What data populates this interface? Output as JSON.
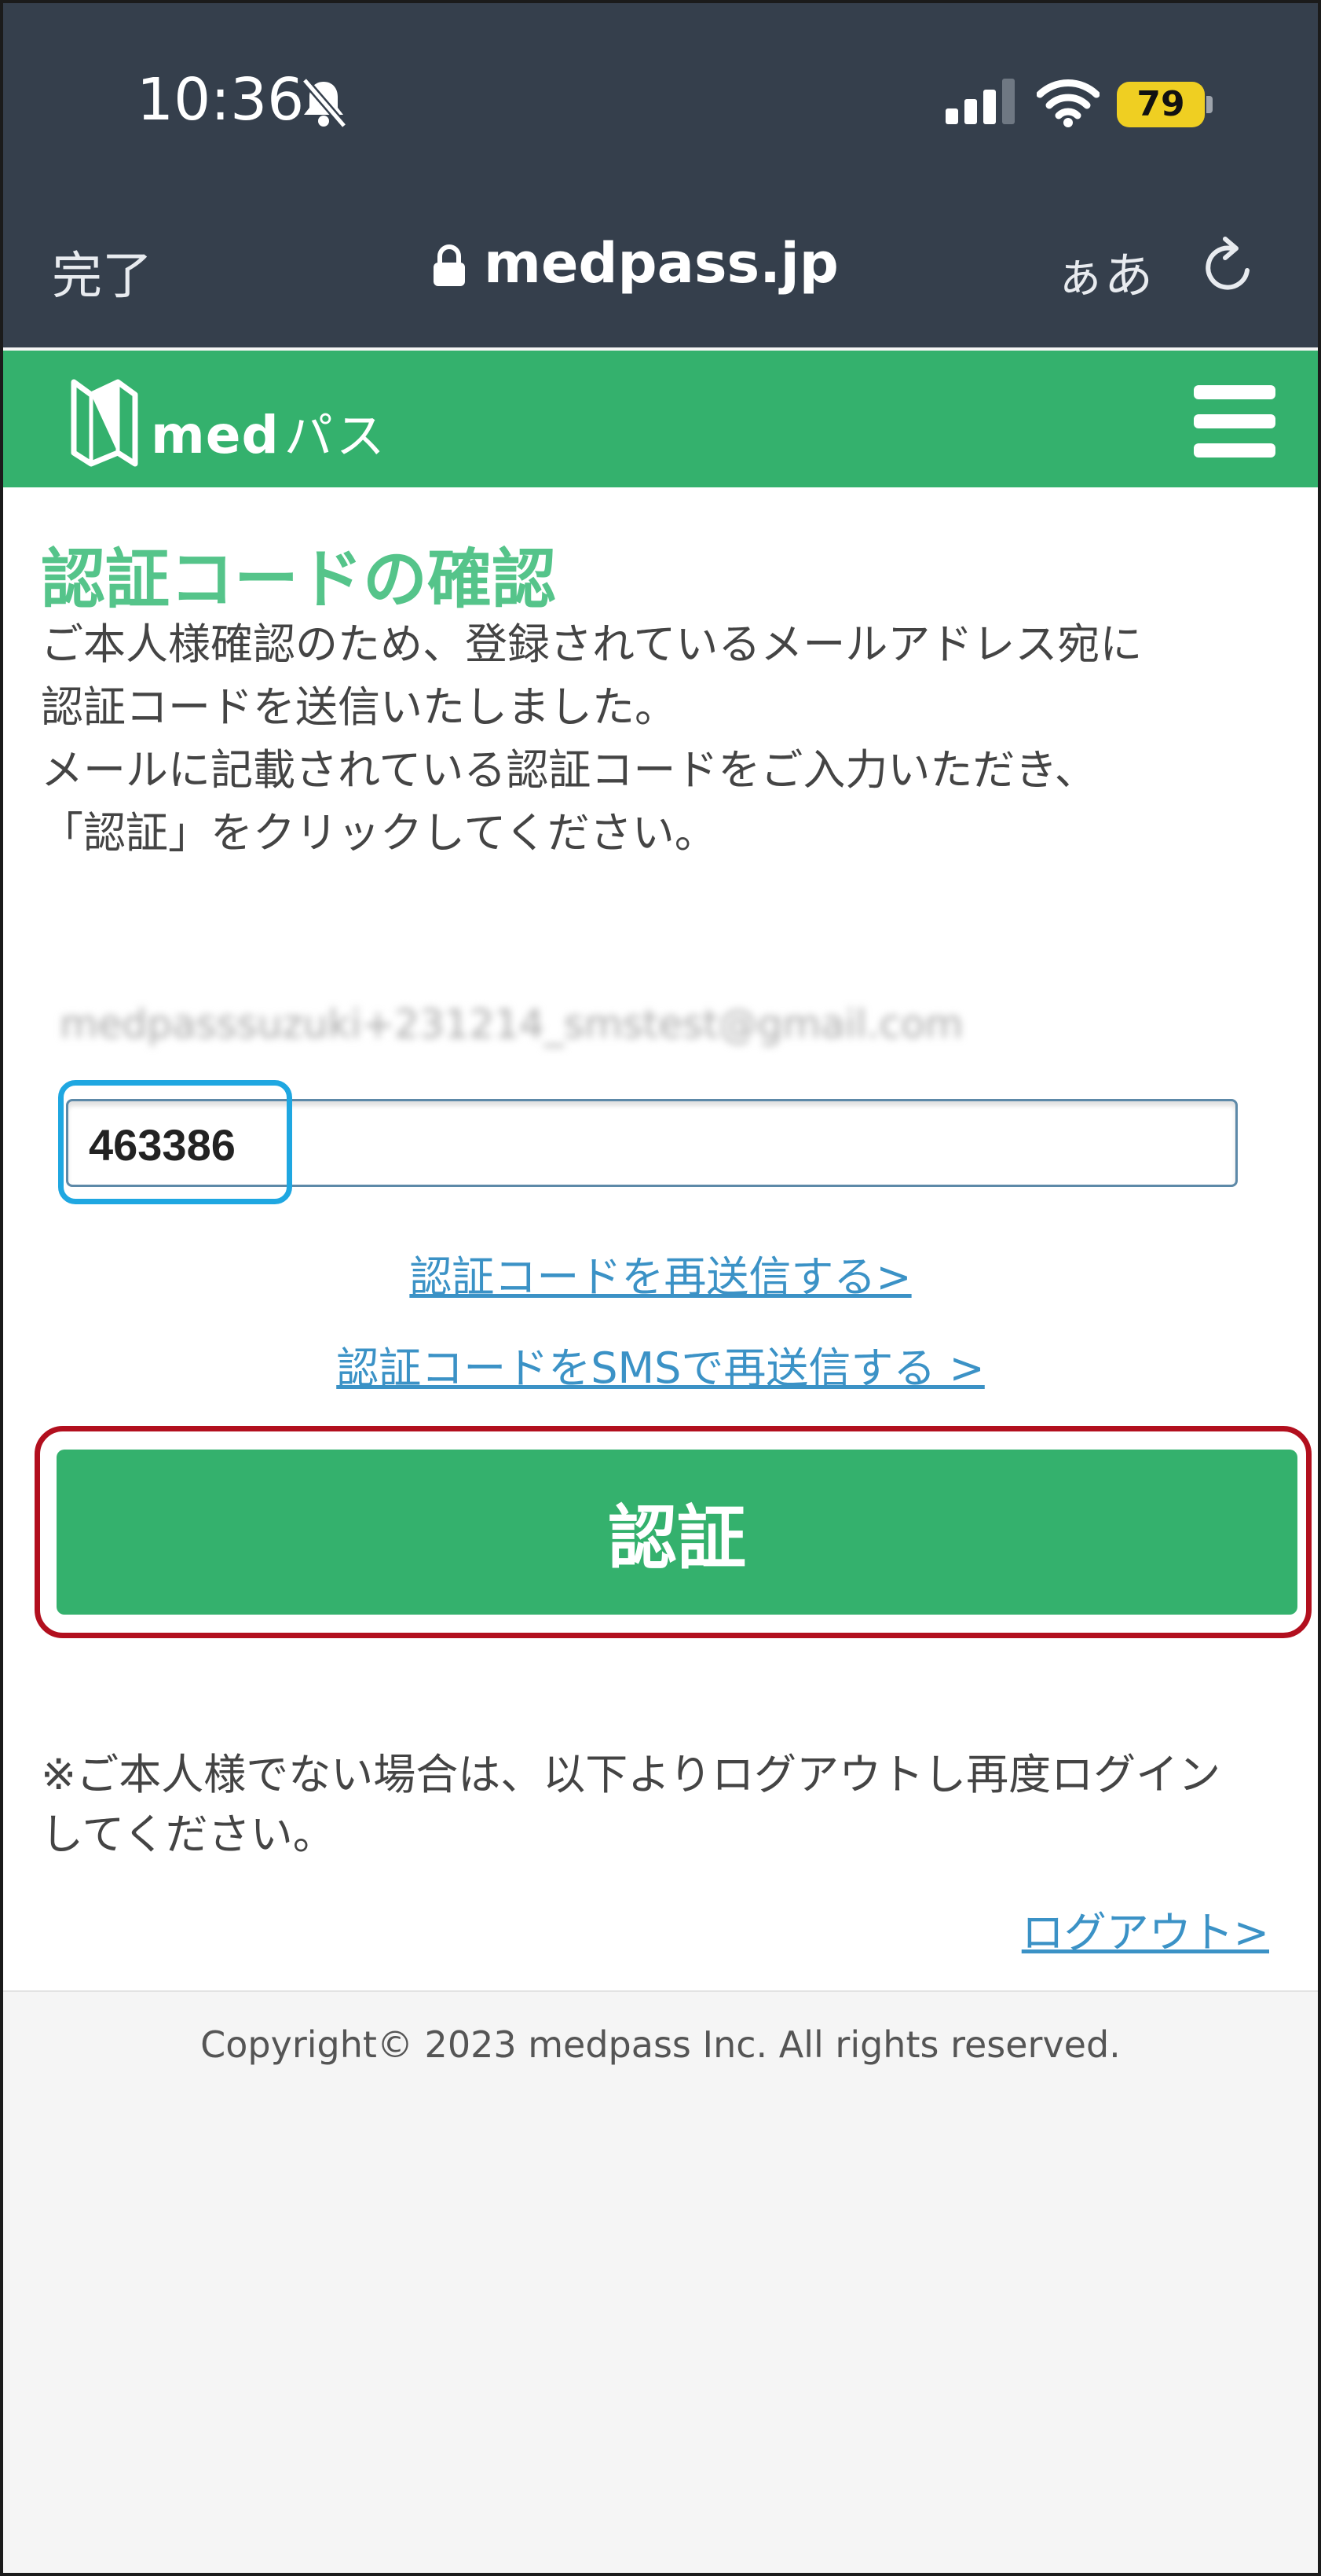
{
  "status_bar": {
    "time": "10:36",
    "battery": "79"
  },
  "browser": {
    "done_label": "完了",
    "url": "medpass.jp",
    "text_size_label": "ぁあ"
  },
  "site_header": {
    "logo_latin": "med",
    "logo_kana": "パス"
  },
  "main": {
    "title": "認証コードの確認",
    "description": [
      "ご本人様確認のため、登録されているメールアドレス宛に",
      "認証コードを送信いたしました。",
      "メールに記載されている認証コードをご入力いただき、",
      "「認証」をクリックしてください。"
    ],
    "email_masked": "medpasssuzuki+231214_smstest@gmail.com",
    "code_value": "463386",
    "resend_link": "認証コードを再送信する>",
    "resend_sms_link": "認証コードをSMSで再送信する >",
    "submit_label": "認証",
    "note": [
      "※ご本人様でない場合は、以下よりログアウトし再度ログイン",
      "してください。"
    ],
    "logout_link": "ログアウト>"
  },
  "footer": {
    "copyright": "Copyright© 2023 medpass Inc. All rights reserved."
  },
  "colors": {
    "chrome_bg": "#353f4c",
    "brand_green": "#34b16d",
    "title_green": "#55c48a",
    "link_blue": "#3b92c6",
    "highlight_blue": "#1fa7e1",
    "highlight_red": "#b20f1e"
  },
  "icons": [
    "bell-slash-icon",
    "signal-icon",
    "wifi-icon",
    "battery-icon",
    "lock-icon",
    "reload-icon",
    "medpass-logo-icon",
    "hamburger-menu-icon"
  ]
}
